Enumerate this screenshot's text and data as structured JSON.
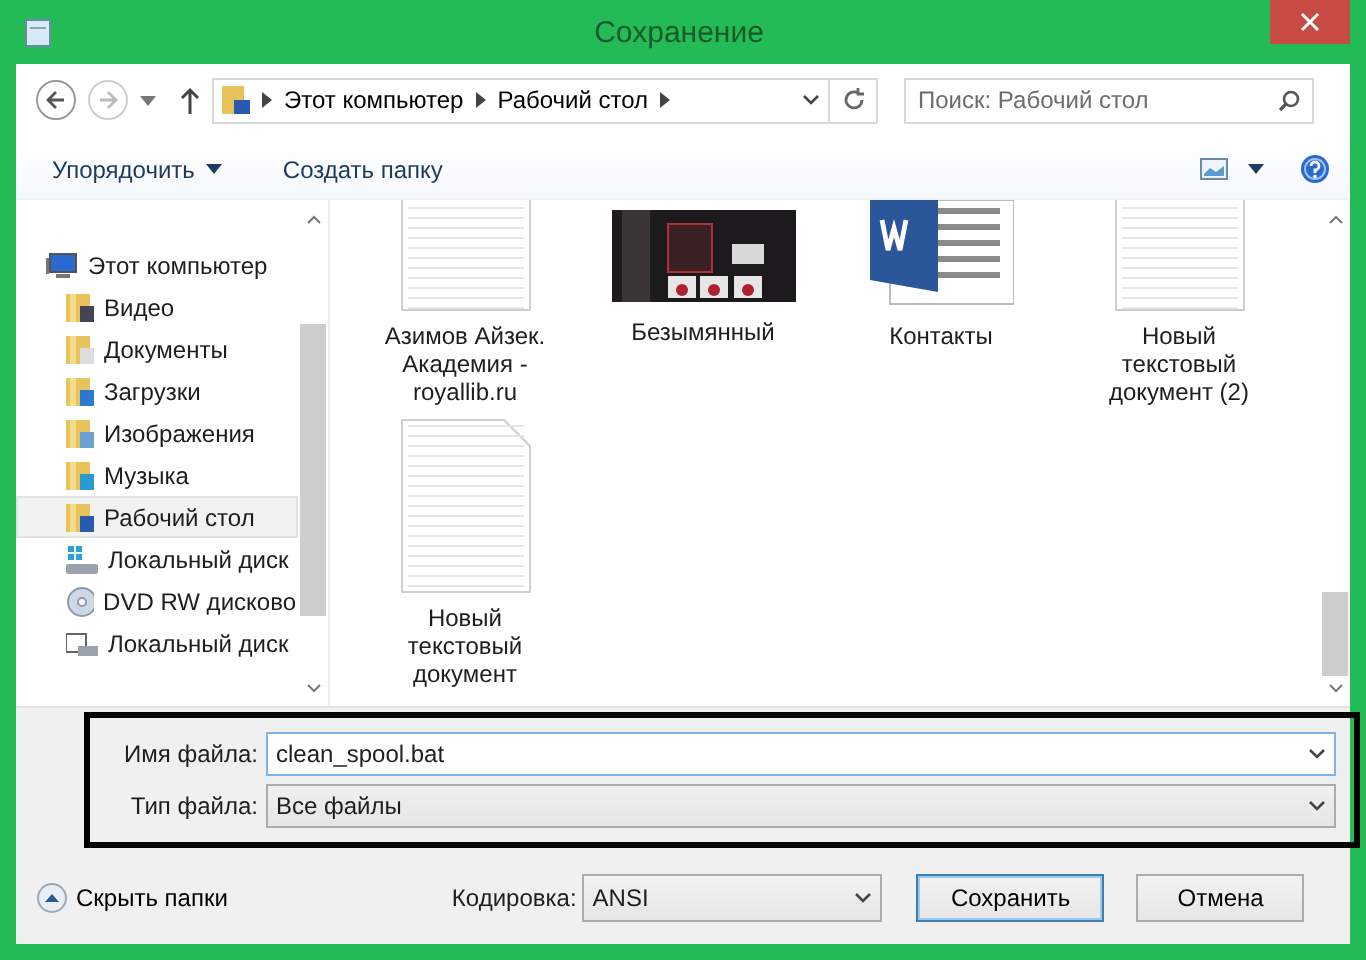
{
  "window": {
    "title": "Сохранение"
  },
  "nav": {
    "path": [
      "Этот компьютер",
      "Рабочий стол"
    ],
    "search": {
      "placeholder": "Поиск: Рабочий стол"
    }
  },
  "toolbar": {
    "organize": "Упорядочить",
    "new_folder": "Создать папку"
  },
  "sidebar": {
    "items": [
      {
        "label": "Этот компьютер",
        "kind": "computer",
        "selected": false,
        "children": [
          {
            "label": "Видео",
            "kind": "video",
            "selected": false
          },
          {
            "label": "Документы",
            "kind": "docs",
            "selected": false
          },
          {
            "label": "Загрузки",
            "kind": "downloads",
            "selected": false
          },
          {
            "label": "Изображения",
            "kind": "pictures",
            "selected": false
          },
          {
            "label": "Музыка",
            "kind": "music",
            "selected": false
          },
          {
            "label": "Рабочий стол",
            "kind": "desktop",
            "selected": true
          },
          {
            "label": "Локальный диск",
            "kind": "disk",
            "selected": false
          },
          {
            "label": "DVD RW дисково",
            "kind": "dvd",
            "selected": false
          },
          {
            "label": "Локальный диск",
            "kind": "disk2",
            "selected": false
          }
        ]
      }
    ]
  },
  "files": [
    {
      "name": "Азимов Айзек.\nАкадемия -\nroyallib.ru",
      "kind": "text"
    },
    {
      "name": "Безымянный",
      "kind": "picture"
    },
    {
      "name": "Контакты",
      "kind": "word"
    },
    {
      "name": "Новый\nтекстовый\nдокумент (2)",
      "kind": "text"
    },
    {
      "name": "Новый\nтекстовый\nдокумент",
      "kind": "text"
    }
  ],
  "form": {
    "filename_label": "Имя файла:",
    "filename": "clean_spool.bat",
    "type_label": "Тип файла:",
    "type": "Все файлы"
  },
  "footer": {
    "hide_folders": "Скрыть папки",
    "encoding_label": "Кодировка:",
    "encoding": "ANSI",
    "buttons": [
      {
        "label": "Сохранить",
        "default": true
      },
      {
        "label": "Отмена",
        "default": false
      }
    ]
  }
}
